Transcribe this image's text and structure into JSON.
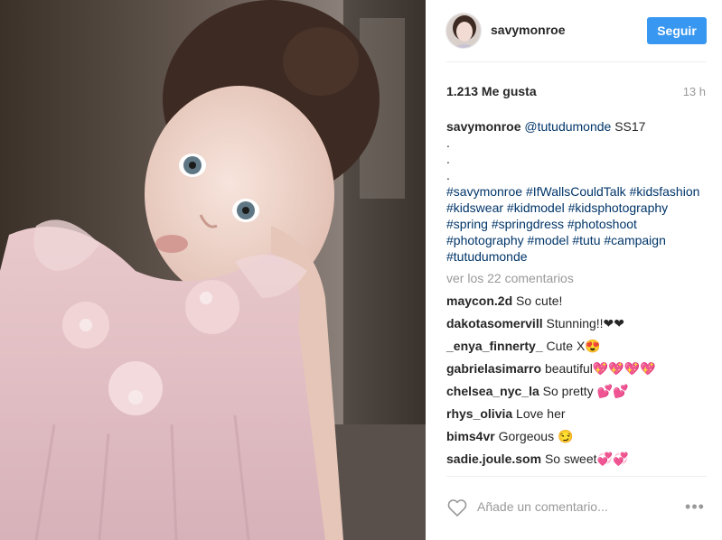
{
  "post": {
    "username": "savymonroe",
    "follow_label": "Seguir",
    "likes": "1.213 Me gusta",
    "time": "13 h"
  },
  "caption": {
    "username": "savymonroe",
    "mention": "@tutudumonde",
    "text_after": " SS17",
    "dot": ".",
    "hashtags": [
      "#savymonroe",
      "#IfWallsCouldTalk",
      "#kidsfashion",
      "#kidswear",
      "#kidmodel",
      "#kidsphotography",
      "#spring",
      "#springdress",
      "#photoshoot",
      "#photography",
      "#model",
      "#tutu",
      "#campaign",
      "#tutudumonde"
    ]
  },
  "view_all": "ver los 22 comentarios",
  "comments": [
    {
      "user": "maycon.2d",
      "text": "So cute!"
    },
    {
      "user": "dakotasomervill",
      "text": "Stunning!!❤❤"
    },
    {
      "user": "_enya_finnerty_",
      "text": "Cute X😍"
    },
    {
      "user": "gabrielasimarro",
      "text": "beautiful💖💖💖💖"
    },
    {
      "user": "chelsea_nyc_la",
      "text": "So pretty 💕💕"
    },
    {
      "user": "rhys_olivia",
      "text": "Love her"
    },
    {
      "user": "bims4vr",
      "text": "Gorgeous 😏"
    },
    {
      "user": "sadie.joule.som",
      "text": "So sweet💞💞"
    }
  ],
  "add_comment": {
    "placeholder": "Añade un comentario...",
    "more": "•••"
  },
  "icons": {
    "like": "heart-outline-icon",
    "more": "more-options-icon"
  },
  "colors": {
    "accent": "#3897f0",
    "link": "#003569",
    "muted": "#999999",
    "text": "#262626"
  }
}
